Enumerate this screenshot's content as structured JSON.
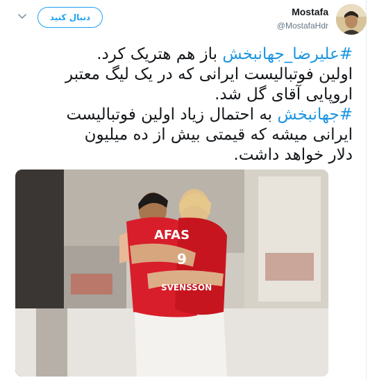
{
  "account": {
    "display_name": "Mostafa",
    "handle": "@MostafaHdr",
    "follow_label": "دنبال کنید"
  },
  "tweet": {
    "line1_hashtag": "#علیرضا_جهانبخش",
    "line1_text": " باز هم هتریک کرد.",
    "line2": "اولین فوتبالیست ایرانی که در یک لیگ معتبر",
    "line3": "اروپایی آقای گل شد.",
    "line4_hashtag": "#جهانبخش",
    "line4_text": " به احتمال زیاد اولین فوتبالیست",
    "line5": "ایرانی میشه که قیمتی بیش از ده میلیون",
    "line6": "دلار خواهد داشت."
  },
  "photo": {
    "front_jersey_sponsor": "AFAS",
    "front_jersey_number": "9",
    "back_player_name": "SVENSSON"
  },
  "colors": {
    "accent": "#1da1f2",
    "hashtag": "#1b95e0",
    "jersey_red": "#d81e2a"
  },
  "icons": {
    "menu": "chevron-down-icon"
  }
}
